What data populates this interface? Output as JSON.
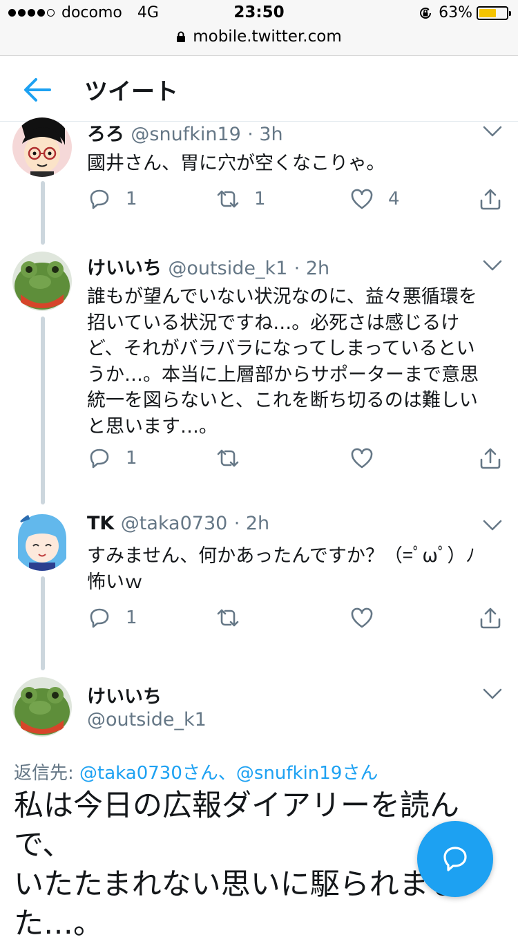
{
  "status_bar": {
    "carrier": "docomo",
    "network": "4G",
    "time": "23:50",
    "battery": "63%",
    "battery_level": 0.63
  },
  "browser": {
    "url": "mobile.twitter.com"
  },
  "header": {
    "title": "ツイート"
  },
  "tweets": [
    {
      "name": "ろろ",
      "handle": "@snufkin19",
      "time": "· 3h",
      "lines": [
        "國井さん、胃に穴が空くなこりゃ。"
      ],
      "reply_count": "1",
      "retweet_count": "1",
      "like_count": "4"
    },
    {
      "name": "けいいち",
      "handle": "@outside_k1",
      "time": "· 2h",
      "lines": [
        "誰もが望んでいない状況なのに、益々悪循環を",
        "招いている状況ですね…。必死さは感じるけ",
        "ど、それがバラバラになってしまっているとい",
        "うか…。本当に上層部からサポーターまで意思",
        "統一を図らないと、これを断ち切るのは難しい",
        "と思います…。"
      ],
      "reply_count": "1",
      "retweet_count": "",
      "like_count": ""
    },
    {
      "name": "TK",
      "handle": "@taka0730",
      "time": "· 2h",
      "lines": [
        "すみません、何かあったんですか？（=ﾟωﾟ）ﾉ",
        "怖いｗ"
      ],
      "reply_count": "1",
      "retweet_count": "",
      "like_count": ""
    }
  ],
  "main_tweet": {
    "name": "けいいち",
    "handle": "@outside_k1",
    "reply_prefix": "返信先: ",
    "reply_to_1": "@taka0730さん",
    "reply_sep": "、",
    "reply_to_2": "@snufkin19さん",
    "lines": [
      "私は今日の広報ダイアリーを読んで、",
      "いたたまれない思いに駆られまし",
      "た…。"
    ]
  },
  "icons": {
    "back": "arrow-left-icon",
    "reply": "reply-icon",
    "retweet": "retweet-icon",
    "like": "heart-icon",
    "share": "share-icon",
    "more": "chevron-down-icon",
    "compose": "compose-reply-icon"
  },
  "colors": {
    "accent": "#1da1f2",
    "secondary_text": "#657786",
    "primary_text": "#14171a",
    "thread_line": "#ccd6dd",
    "battery": "#f5c400"
  }
}
